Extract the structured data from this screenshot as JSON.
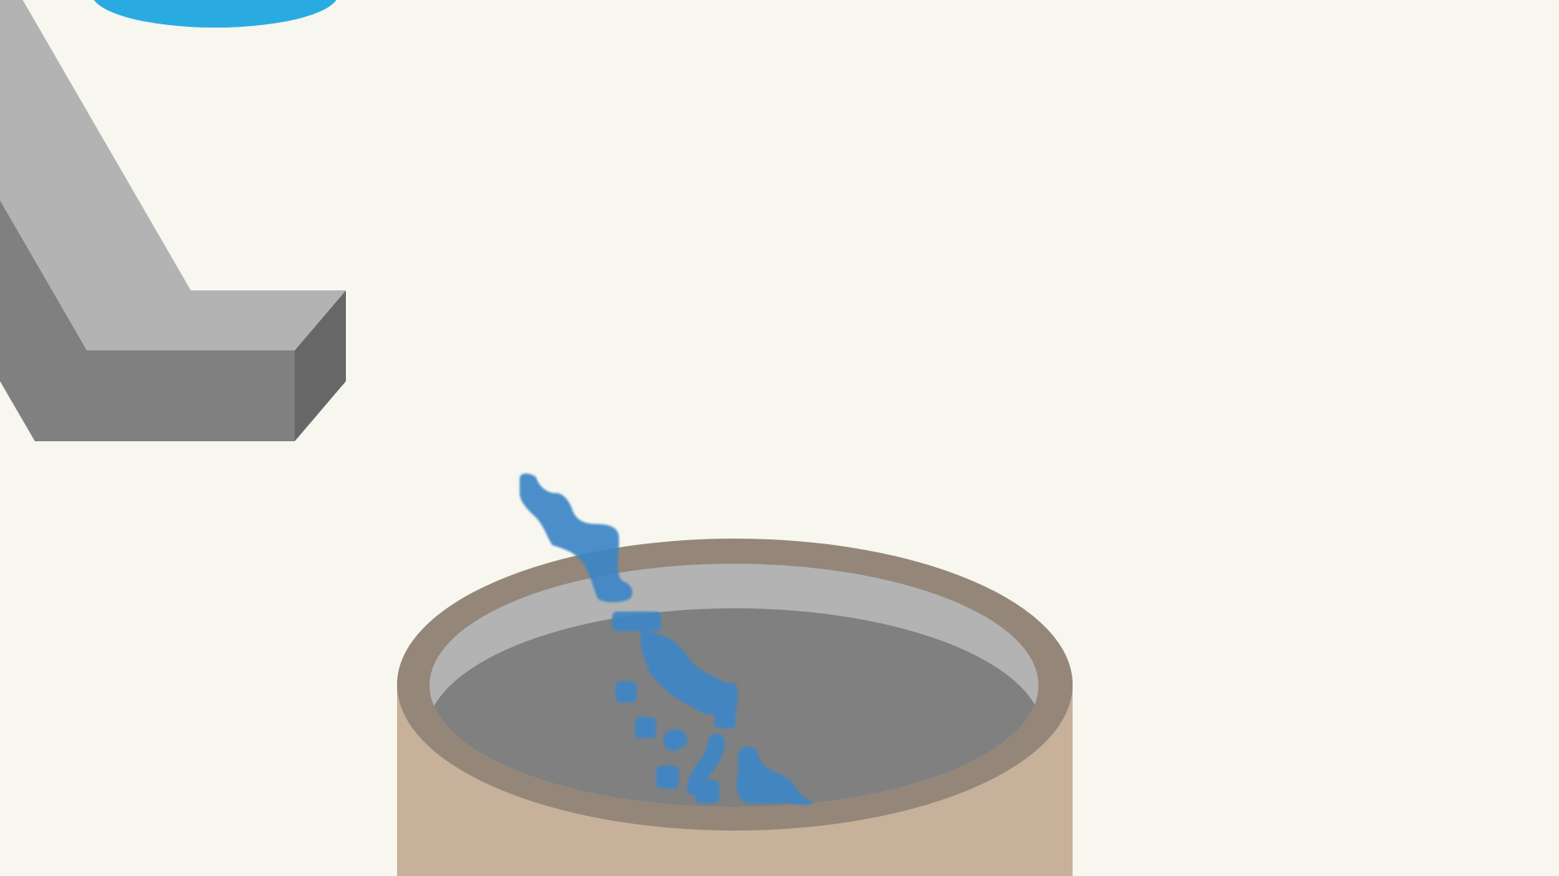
{
  "game": {
    "colors": {
      "background": "#f7f7ef",
      "rampTop": "#b3b3b3",
      "rampFront": "#808080",
      "rampSide": "#676767",
      "waterSourceBlue": "#29abe2",
      "cupRim": "#948779",
      "cupBody": "#c8b19a",
      "cupInnerWall": "#b3b3b3",
      "cupInnerFloor": "#808080",
      "waterDrops": "#3d86c6"
    },
    "objects": [
      {
        "name": "water-source",
        "icon": "blue-ellipse-water-source"
      },
      {
        "name": "ramp",
        "icon": "gray-isometric-ramp"
      },
      {
        "name": "water-stream",
        "icon": "falling-water-droplets"
      },
      {
        "name": "cup",
        "icon": "open-beige-cylinder-cup"
      }
    ]
  }
}
